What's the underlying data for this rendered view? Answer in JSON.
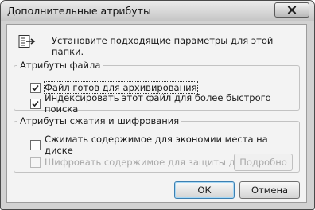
{
  "window": {
    "title": "Дополнительные атрибуты"
  },
  "intro": "Установите подходящие параметры для этой папки.",
  "file_attributes": {
    "legend": "Атрибуты файла",
    "options": [
      {
        "label": "Файл готов для архивирования",
        "checked": true
      },
      {
        "label": "Индексировать этот файл для более быстрого поиска",
        "checked": true
      }
    ]
  },
  "compression": {
    "legend": "Атрибуты сжатия и шифрования",
    "options": [
      {
        "label": "Сжимать содержимое для экономии места на диске",
        "checked": false
      },
      {
        "label": "Шифровать содержимое для защиты данных",
        "checked": false,
        "disabled": true
      }
    ],
    "details_button": "Подробно"
  },
  "buttons": {
    "ok": "ОК",
    "cancel": "Отмена"
  },
  "icons": {
    "close": "close-icon",
    "folder": "folder-icon",
    "check": "checkmark-icon"
  }
}
